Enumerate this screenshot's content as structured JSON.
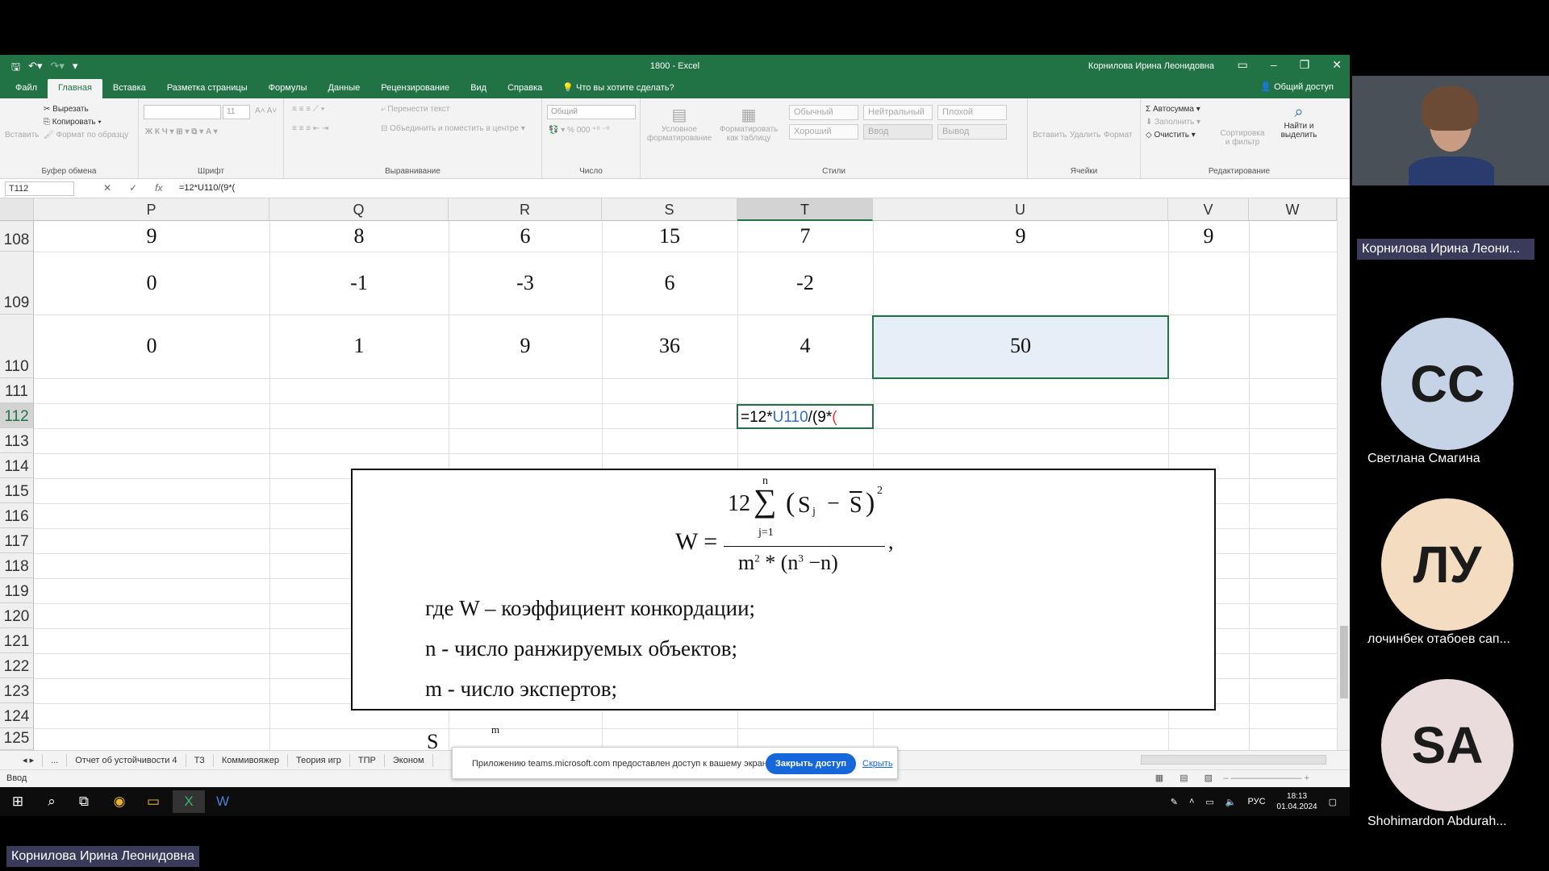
{
  "excel": {
    "title": "1800  -  Excel",
    "user": "Корнилова Ирина Леонидовна",
    "tabs": [
      "Файл",
      "Главная",
      "Вставка",
      "Разметка страницы",
      "Формулы",
      "Данные",
      "Рецензирование",
      "Вид",
      "Справка"
    ],
    "tell_me": "Что вы хотите сделать?",
    "share": "Общий доступ",
    "ribbon": {
      "clipboard": {
        "label": "Буфер обмена",
        "paste": "Вставить",
        "cut": "Вырезать",
        "copy": "Копировать",
        "format_painter": "Формат по образцу"
      },
      "font": {
        "label": "Шрифт",
        "size": "11"
      },
      "alignment": {
        "label": "Выравнивание",
        "wrap": "Перенести текст",
        "merge": "Объединить и поместить в центре"
      },
      "number": {
        "label": "Число",
        "format": "Общий"
      },
      "styles": {
        "label": "Стили",
        "conditional": "Условное форматирование",
        "as_table": "Форматировать как таблицу",
        "normal": "Обычный",
        "neutral": "Нейтральный",
        "bad": "Плохой",
        "good": "Хороший",
        "input": "Ввод",
        "output": "Вывод"
      },
      "cells": {
        "label": "Ячейки",
        "insert": "Вставить",
        "delete": "Удалить",
        "format": "Формат"
      },
      "editing": {
        "label": "Редактирование",
        "autosum": "Автосумма",
        "fill": "Заполнить",
        "clear": "Очистить",
        "sort": "Сортировка и фильтр",
        "find": "Найти и выделить"
      }
    },
    "name_box": "T112",
    "formula": "=12*U110/(9*(",
    "columns": [
      "P",
      "Q",
      "R",
      "S",
      "T",
      "U",
      "V",
      "W"
    ],
    "rows": [
      "108",
      "109",
      "110",
      "111",
      "112",
      "113",
      "114",
      "115",
      "116",
      "117",
      "118",
      "119",
      "120",
      "121",
      "122",
      "123",
      "124",
      "125"
    ],
    "row108": [
      "9",
      "8",
      "6",
      "15",
      "7",
      "9",
      "9"
    ],
    "row109": [
      "0",
      "-1",
      "-3",
      "6",
      "-2"
    ],
    "row110": [
      "0",
      "1",
      "9",
      "36",
      "4",
      "50"
    ],
    "edit_cell": {
      "prefix": "=12*",
      "ref": "U110",
      "mid": "/(9*",
      "paren": "("
    },
    "formula_image": {
      "lhs": "W =",
      "coef": "12",
      "sum_top": "n",
      "sum_bottom": "j=1",
      "S": "S",
      "j": "j",
      "minus": "−",
      "Sbar": "S",
      "sq": "2",
      "den_m": "m",
      "den_sq": "2",
      "den_mid": " * (n",
      "den_cube": "3",
      "den_end": " −n)",
      "comma": ",",
      "line1": "где W – коэффициент конкордации;",
      "line2": "n - число ранжируемых объектов;",
      "line3": "m - число экспертов;",
      "partial_m": "m",
      "partial_S": "S"
    },
    "sheets": [
      "...",
      "Отчет об устойчивости 4",
      "ТЗ",
      "Коммивояжер",
      "Теория игр",
      "ТПР",
      "Эконом"
    ],
    "status_mode": "Ввод"
  },
  "share_banner": {
    "message": "Приложению teams.microsoft.com предоставлен доступ к вашему экрану.",
    "stop": "Закрыть доступ",
    "hide": "Скрыть"
  },
  "taskbar": {
    "lang": "РУС",
    "time": "18:13",
    "date": "01.04.2024"
  },
  "participants": {
    "video_name": "Корнилова Ирина Леони...",
    "list": [
      {
        "initials": "СС",
        "name": "Светлана Смагина",
        "color": "#c6d3e6"
      },
      {
        "initials": "ЛУ",
        "name": "лочинбек отабоев сап...",
        "color": "#f3dcbf"
      },
      {
        "initials": "SA",
        "name": "Shohimardon Abdurah...",
        "color": "#eadcdc"
      }
    ]
  },
  "presenter": "Корнилова Ирина Леонидовна"
}
